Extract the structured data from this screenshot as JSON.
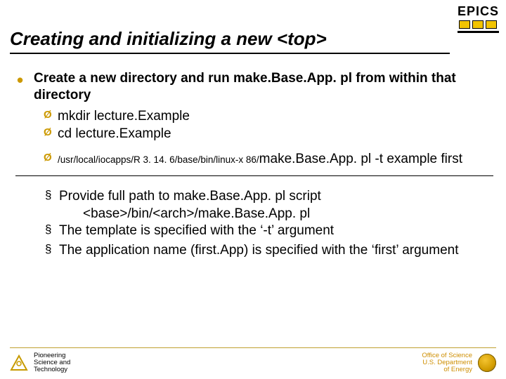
{
  "logo": {
    "text": "EPICS"
  },
  "title": "Creating and initializing a new <top>",
  "bullets": {
    "b1": "Create a new directory and run make.Base.App. pl from within that directory",
    "b1a": "mkdir lecture.Example",
    "b1b": "cd lecture.Example",
    "b1c_small": "/usr/local/iocapps/R 3. 14. 6/base/bin/linux-x 86/",
    "b1c_big": "make.Base.App. pl -t example first",
    "s1": "Provide full path to make.Base.App. pl script",
    "s1a": "<base>/bin/<arch>/make.Base.App. pl",
    "s2": "The template is specified with the ‘-t’ argument",
    "s3": "The application name (first.App) is specified with the ‘first’ argument"
  },
  "footer": {
    "left1": "Pioneering",
    "left2": "Science and",
    "left3": "Technology",
    "right1": "Office of Science",
    "right2": "U.S. Department",
    "right3": "of Energy"
  }
}
